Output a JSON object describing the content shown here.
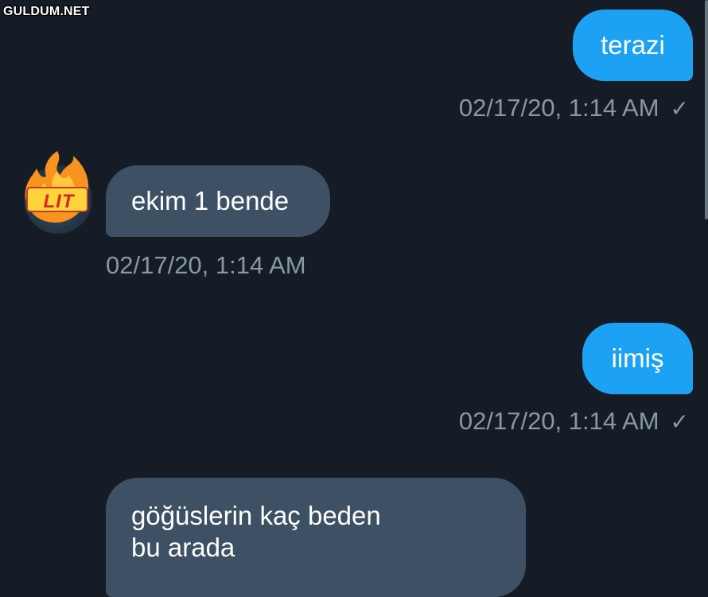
{
  "watermark": "GULDUM.NET",
  "avatar": {
    "badge_text": "LIT",
    "icon": "fire-lit-emoji"
  },
  "messages": [
    {
      "direction": "out",
      "text": "terazi",
      "timestamp": "02/17/20, 1:14 AM",
      "status_icon": "checkmark-icon"
    },
    {
      "direction": "in",
      "text": "ekim 1 bende",
      "timestamp": "02/17/20, 1:14 AM"
    },
    {
      "direction": "out",
      "text": "iimiş",
      "timestamp": "02/17/20, 1:14 AM",
      "status_icon": "checkmark-icon"
    },
    {
      "direction": "in",
      "lines": [
        "göğüslerin kaç beden",
        "bu arada"
      ]
    }
  ],
  "colors": {
    "background": "#151c25",
    "outgoing_bubble": "#1da1f2",
    "incoming_bubble": "#3d5064",
    "timestamp": "#8899a6"
  }
}
